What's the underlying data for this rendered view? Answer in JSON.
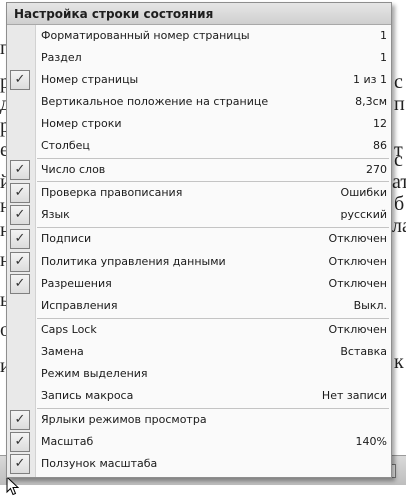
{
  "background": {
    "fragments": [
      "п",
      "р",
      "д",
      "р",
      "е",
      "й",
      "н",
      "н",
      "н",
      "ы",
      "о",
      "и",
      "с",
      "п",
      "т",
      "с",
      "ат",
      "б",
      "ла",
      "к"
    ]
  },
  "menu": {
    "title": "Настройка строки состояния",
    "items": [
      {
        "label": "Форматированный номер страницы",
        "value": "1",
        "checked": false
      },
      {
        "label": "Раздел",
        "value": "1",
        "checked": false
      },
      {
        "label": "Номер страницы",
        "value": "1 из 1",
        "checked": true
      },
      {
        "label": "Вертикальное положение на странице",
        "value": "8,3см",
        "checked": false
      },
      {
        "label": "Номер строки",
        "value": "12",
        "checked": false
      },
      {
        "label": "Столбец",
        "value": "86",
        "checked": false
      },
      {
        "label": "Число слов",
        "value": "270",
        "checked": true
      },
      {
        "label": "Проверка правописания",
        "value": "Ошибки",
        "checked": true
      },
      {
        "label": "Язык",
        "value": "русский",
        "checked": true
      },
      {
        "label": "Подписи",
        "value": "Отключен",
        "checked": true
      },
      {
        "label": "Политика управления данными",
        "value": "Отключен",
        "checked": true
      },
      {
        "label": "Разрешения",
        "value": "Отключен",
        "checked": true
      },
      {
        "label": "Исправления",
        "value": "Выкл.",
        "checked": false
      },
      {
        "label": "Caps Lock",
        "value": "Отключен",
        "checked": false
      },
      {
        "label": "Замена",
        "value": "Вставка",
        "checked": false
      },
      {
        "label": "Режим выделения",
        "value": "",
        "checked": false
      },
      {
        "label": "Запись макроса",
        "value": "Нет записи",
        "checked": false
      },
      {
        "label": "Ярлыки режимов просмотра",
        "value": "",
        "checked": true
      },
      {
        "label": "Масштаб",
        "value": "140%",
        "checked": true
      },
      {
        "label": "Ползунок масштаба",
        "value": "",
        "checked": true
      }
    ],
    "check_glyph": "✓"
  }
}
